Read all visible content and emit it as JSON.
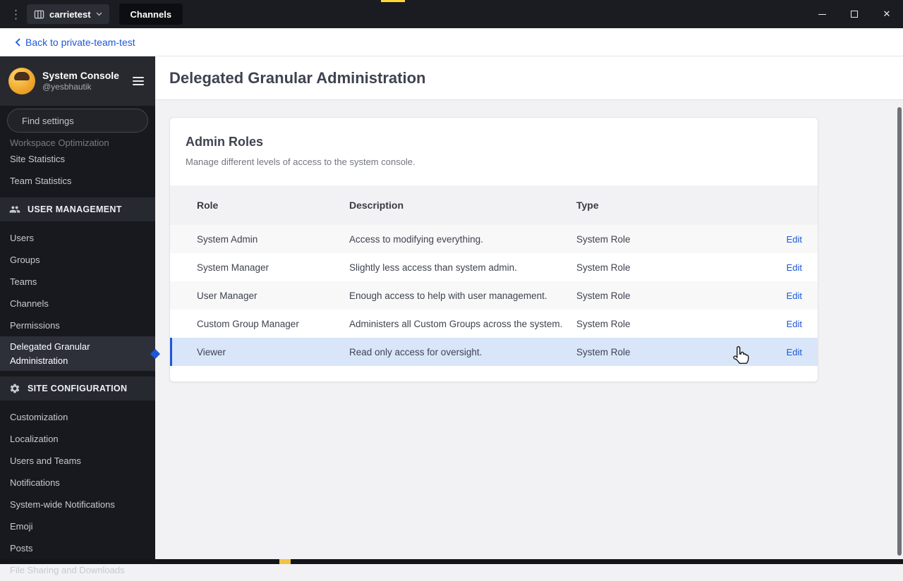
{
  "window": {
    "team_name": "carrietest",
    "tab": "Channels",
    "icons": {
      "kebab": "⋮",
      "close": "✕"
    }
  },
  "back_bar": {
    "label": "Back to private-team-test"
  },
  "page": {
    "title": "Delegated Granular Administration"
  },
  "sidebar": {
    "title": "System Console",
    "subtitle": "@yesbhautik",
    "search_placeholder": "Find settings",
    "items_top": [
      "Workspace Optimization",
      "Site Statistics",
      "Team Statistics"
    ],
    "section_user_mgmt": {
      "label": "USER MANAGEMENT",
      "items": [
        "Users",
        "Groups",
        "Teams",
        "Channels",
        "Permissions"
      ],
      "active_item": "Delegated Granular Administration"
    },
    "section_site_config": {
      "label": "SITE CONFIGURATION",
      "items": [
        "Customization",
        "Localization",
        "Users and Teams",
        "Notifications",
        "System-wide Notifications",
        "Emoji",
        "Posts",
        "File Sharing and Downloads"
      ]
    }
  },
  "card": {
    "title": "Admin Roles",
    "subtitle": "Manage different levels of access to the system console."
  },
  "table": {
    "columns": [
      "Role",
      "Description",
      "Type"
    ],
    "edit_label": "Edit",
    "rows": [
      {
        "role": "System Admin",
        "description": "Access to modifying everything.",
        "type": "System Role"
      },
      {
        "role": "System Manager",
        "description": "Slightly less access than system admin.",
        "type": "System Role"
      },
      {
        "role": "User Manager",
        "description": "Enough access to help with user management.",
        "type": "System Role"
      },
      {
        "role": "Custom Group Manager",
        "description": "Administers all Custom Groups across the system.",
        "type": "System Role"
      },
      {
        "role": "Viewer",
        "description": "Read only access for oversight.",
        "type": "System Role"
      }
    ]
  },
  "colors": {
    "accent": "#1c58d9",
    "row_highlight": "#d9e6f9"
  }
}
